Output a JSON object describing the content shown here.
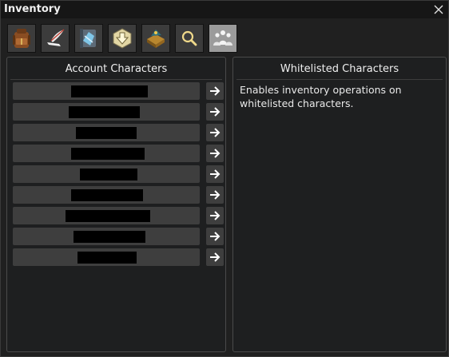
{
  "window": {
    "title": "Inventory"
  },
  "toolbar": {
    "tools": [
      {
        "icon": "backpack-icon",
        "selected": false
      },
      {
        "icon": "quill-icon",
        "selected": false
      },
      {
        "icon": "crystal-panel-icon",
        "selected": false
      },
      {
        "icon": "deposit-arrow-icon",
        "selected": false
      },
      {
        "icon": "treasure-chest-icon",
        "selected": false
      },
      {
        "icon": "magnifier-icon",
        "selected": false
      },
      {
        "icon": "people-group-icon",
        "selected": true
      }
    ]
  },
  "account_panel": {
    "title": "Account Characters",
    "rows": [
      {
        "name": "",
        "redacted": true
      },
      {
        "name": "",
        "redacted": true
      },
      {
        "name": "",
        "redacted": true
      },
      {
        "name": "",
        "redacted": true
      },
      {
        "name": "",
        "redacted": true
      },
      {
        "name": "",
        "redacted": true
      },
      {
        "name": "",
        "redacted": true
      },
      {
        "name": "",
        "redacted": true
      },
      {
        "name": "",
        "redacted": true
      }
    ],
    "row_action_icon": "arrow-right-icon"
  },
  "whitelist_panel": {
    "title": "Whitelisted Characters",
    "description": "Enables inventory operations on whitelisted characters."
  },
  "colors": {
    "window_bg": "#202020",
    "titlebar_bg": "#161616",
    "row_bg": "#3e3e3e",
    "active_tool_bg": "#9b9b9b",
    "text": "#e9e9e9"
  }
}
